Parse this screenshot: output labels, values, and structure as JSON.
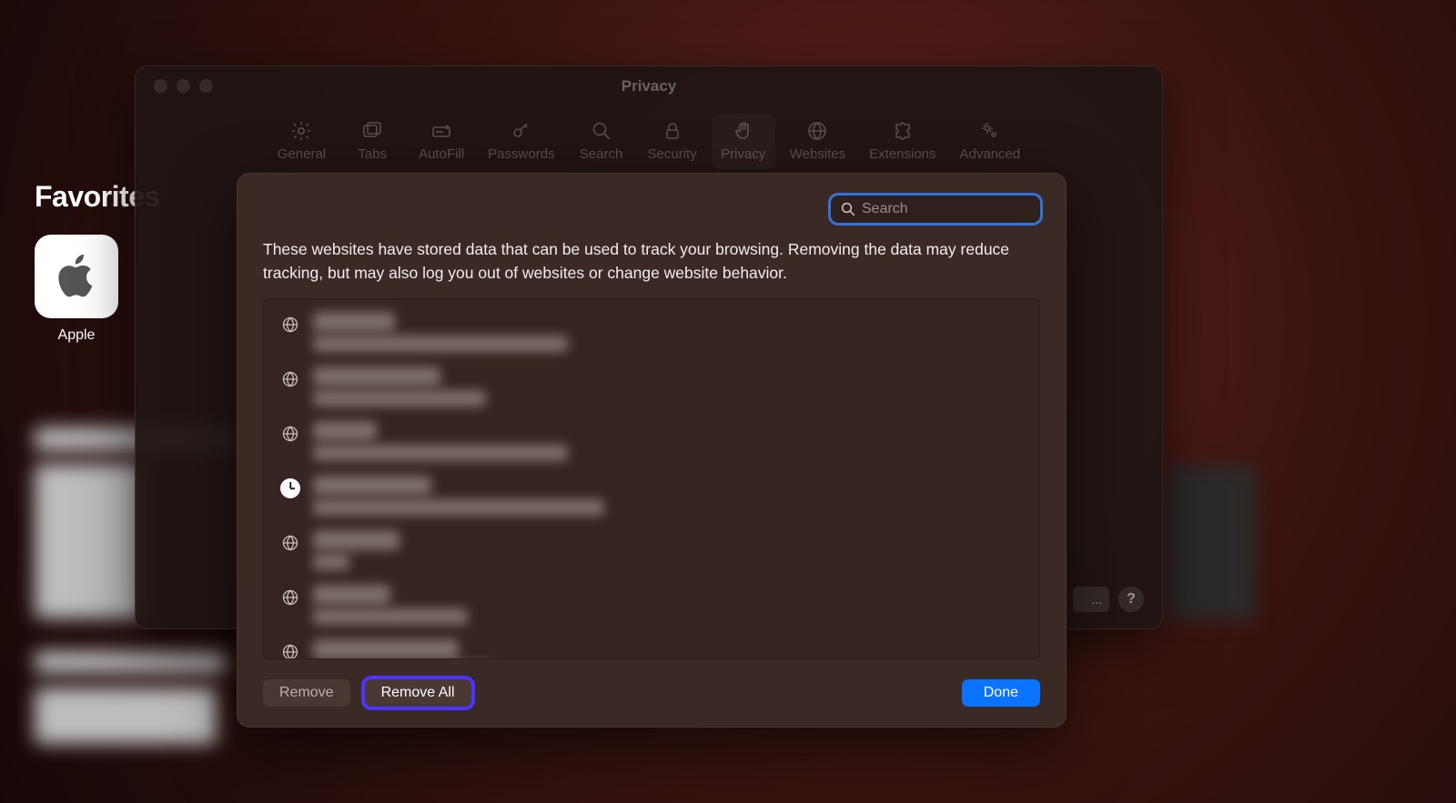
{
  "background": {
    "favorites_heading": "Favorites",
    "apple_label": "Apple"
  },
  "prefs": {
    "title": "Privacy",
    "tabs": [
      {
        "label": "General",
        "icon": "gear-icon",
        "selected": false
      },
      {
        "label": "Tabs",
        "icon": "tabs-icon",
        "selected": false
      },
      {
        "label": "AutoFill",
        "icon": "autofill-icon",
        "selected": false
      },
      {
        "label": "Passwords",
        "icon": "key-icon",
        "selected": false
      },
      {
        "label": "Search",
        "icon": "search-icon",
        "selected": false
      },
      {
        "label": "Security",
        "icon": "lock-icon",
        "selected": false
      },
      {
        "label": "Privacy",
        "icon": "hand-icon",
        "selected": true
      },
      {
        "label": "Websites",
        "icon": "globe-icon",
        "selected": false
      },
      {
        "label": "Extensions",
        "icon": "puzzle-icon",
        "selected": false
      },
      {
        "label": "Advanced",
        "icon": "gears-icon",
        "selected": false
      }
    ],
    "details_button": "...",
    "help_button": "?"
  },
  "sheet": {
    "search_placeholder": "Search",
    "description": "These websites have stored data that can be used to track your browsing. Removing the data may reduce tracking, but may also log you out of websites or change website behavior.",
    "rows": [
      {
        "icon": "globe",
        "domain_w": 90,
        "detail_w": 280
      },
      {
        "icon": "globe",
        "domain_w": 140,
        "detail_w": 190
      },
      {
        "icon": "globe",
        "domain_w": 70,
        "detail_w": 280
      },
      {
        "icon": "clock",
        "domain_w": 130,
        "detail_w": 320
      },
      {
        "icon": "globe",
        "domain_w": 95,
        "detail_w": 40
      },
      {
        "icon": "globe",
        "domain_w": 85,
        "detail_w": 170
      },
      {
        "icon": "globe",
        "domain_w": 160,
        "detail_w": 200
      }
    ],
    "remove_label": "Remove",
    "remove_all_label": "Remove All",
    "done_label": "Done"
  }
}
